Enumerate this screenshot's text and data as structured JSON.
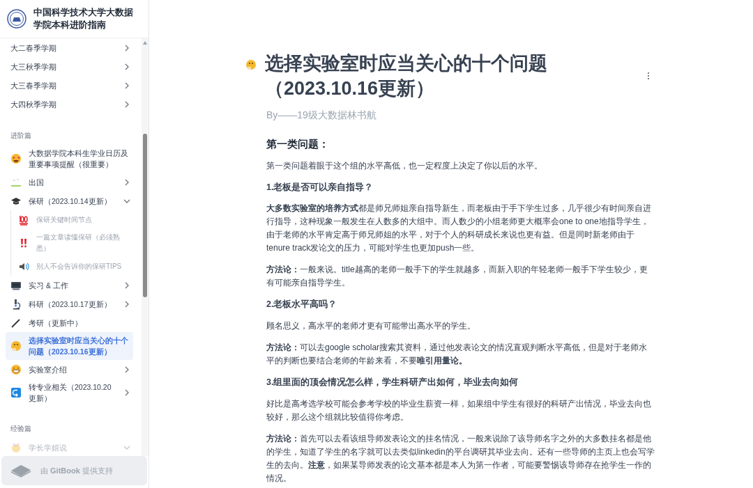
{
  "site": {
    "title": "中国科学技术大学大数据学院本科进阶指南"
  },
  "sidebar": {
    "items": [
      {
        "kind": "link",
        "label": "大二春季学期",
        "expandable": true,
        "expanded": false,
        "selected": false
      },
      {
        "kind": "link",
        "label": "大三秋季学期",
        "expandable": true,
        "expanded": false,
        "selected": false
      },
      {
        "kind": "link",
        "label": "大三春季学期",
        "expandable": true,
        "expanded": false,
        "selected": false
      },
      {
        "kind": "link",
        "label": "大四秋季学期",
        "expandable": true,
        "expanded": false,
        "selected": false
      },
      {
        "kind": "section",
        "label": "进阶篇"
      },
      {
        "kind": "link",
        "label": "大数据学院本科生学业日历及重要事项提醒（很重要）",
        "expandable": false,
        "selected": false
      },
      {
        "kind": "link",
        "label": "出国",
        "expandable": true,
        "expanded": false,
        "selected": false
      },
      {
        "kind": "link",
        "label": "保研（2023.10.14更新）",
        "expandable": true,
        "expanded": true,
        "selected": false,
        "children": [
          {
            "label": "保研关键时间节点",
            "selected": false
          },
          {
            "label": "一篇文章读懂保研（必须熟悉）",
            "selected": false
          },
          {
            "label": "别人不会告诉你的保研TIPS",
            "selected": false
          }
        ]
      },
      {
        "kind": "link",
        "label": "实习 & 工作",
        "expandable": true,
        "expanded": false,
        "selected": false
      },
      {
        "kind": "link",
        "label": "科研（2023.10.17更新）",
        "expandable": true,
        "expanded": false,
        "selected": false
      },
      {
        "kind": "link",
        "label": "考研（更新中）",
        "expandable": false,
        "selected": false
      },
      {
        "kind": "link",
        "label": "选择实验室时应当关心的十个问题（2023.10.16更新）",
        "expandable": false,
        "selected": true
      },
      {
        "kind": "link",
        "label": "实验室介绍",
        "expandable": true,
        "expanded": false,
        "selected": false
      },
      {
        "kind": "link",
        "label": "转专业相关（2023.10.20更新）",
        "expandable": true,
        "expanded": false,
        "selected": false
      },
      {
        "kind": "section",
        "label": "经验篇"
      },
      {
        "kind": "faded",
        "label": "学长学姐说",
        "expandable": true,
        "expanded": true
      }
    ]
  },
  "footer": {
    "label": "由 **GitBook** 提供支持"
  },
  "page": {
    "title": "选择实验室时应当关心的十个问题（2023.10.16更新）",
    "byline": "By——19级大数据林书航",
    "blocks": [
      {
        "kind": "heading",
        "text": "第一类问题："
      },
      {
        "kind": "paragraph",
        "text": "第一类问题着眼于这个组的水平高低，也一定程度上决定了你以后的水平。"
      },
      {
        "kind": "subheading",
        "text": "1.老板是否可以亲自指导？"
      },
      {
        "kind": "paragraph",
        "text": "**大多数实验室的培养方式**都是师兄师姐亲自指导新生，而老板由于手下学生过多，几乎很少有时间亲自进行指导，这种现象一般发生在人数多的大组中。而人数少的小组老师更大概率会one to one地指导学生，由于老师的水平肯定高于师兄师姐的水平，对于个人的科研成长来说也更有益。但是同时新老师由于tenure track发论文的压力，可能对学生也更加push一些。"
      },
      {
        "kind": "paragraph",
        "text": "**方法论：**一般来说。title越高的老师一般手下的学生就越多，而新入职的年轻老师一般手下学生较少，更有可能亲自指导学生。"
      },
      {
        "kind": "subheading",
        "text": "2.老板水平高吗？"
      },
      {
        "kind": "paragraph",
        "text": "顾名思义，高水平的老师才更有可能带出高水平的学生。"
      },
      {
        "kind": "paragraph",
        "text": "**方法论：**可以去google scholar搜索其资料，通过他发表论文的情况直观判断水平高低，但是对于老师水平的判断也要结合老师的年龄来看，不要**唯引用量论。**"
      },
      {
        "kind": "subheading",
        "text": "3.组里面的顶会情况怎么样，学生科研产出如何，毕业去向如何"
      },
      {
        "kind": "paragraph",
        "text": "好比是高考选学校可能会参考学校的毕业生薪资一样，如果组中学生有很好的科研产出情况，毕业去向也较好，那么这个组就比较值得你考虑。"
      },
      {
        "kind": "paragraph",
        "text": "**方法论：**首先可以去看该组导师发表论文的挂名情况，一般来说除了该导师名字之外的大多数挂名都是他的学生，知道了学生的名字就可以去类似linkedin的平台调研其毕业去向。还有一些导师的主页上也会写学生的去向。**注意**，如果某导师发表的论文基本都是本人为第一作者，可能要警惕该导师存在抢学生一作的情况。"
      }
    ]
  }
}
